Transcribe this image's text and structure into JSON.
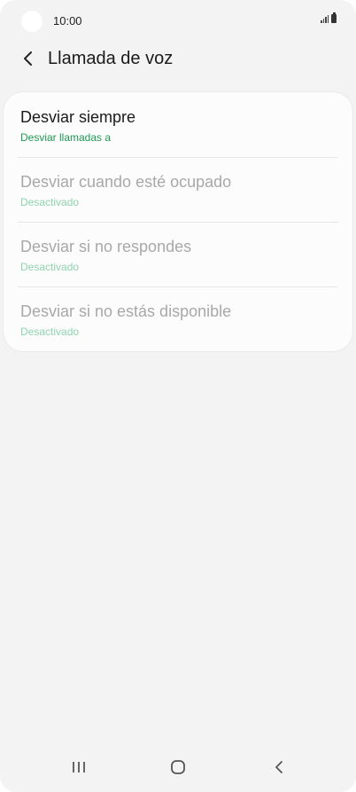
{
  "status_bar": {
    "time": "10:00"
  },
  "header": {
    "title": "Llamada de voz",
    "back_icon": "chevron-left-icon"
  },
  "forwarding_options": [
    {
      "title": "Desviar siempre",
      "subtitle": "Desviar llamadas a",
      "enabled": true
    },
    {
      "title": "Desviar cuando esté ocupado",
      "subtitle": "Desactivado",
      "enabled": false
    },
    {
      "title": "Desviar si no respondes",
      "subtitle": "Desactivado",
      "enabled": false
    },
    {
      "title": "Desviar si no estás disponible",
      "subtitle": "Desactivado",
      "enabled": false
    }
  ],
  "colors": {
    "accent_green": "#1f9a55",
    "disabled_green": "#8fd3ae",
    "background": "#f3f3f3"
  },
  "nav_bar": {
    "icons": [
      "recent-apps-icon",
      "home-icon",
      "back-icon"
    ]
  }
}
